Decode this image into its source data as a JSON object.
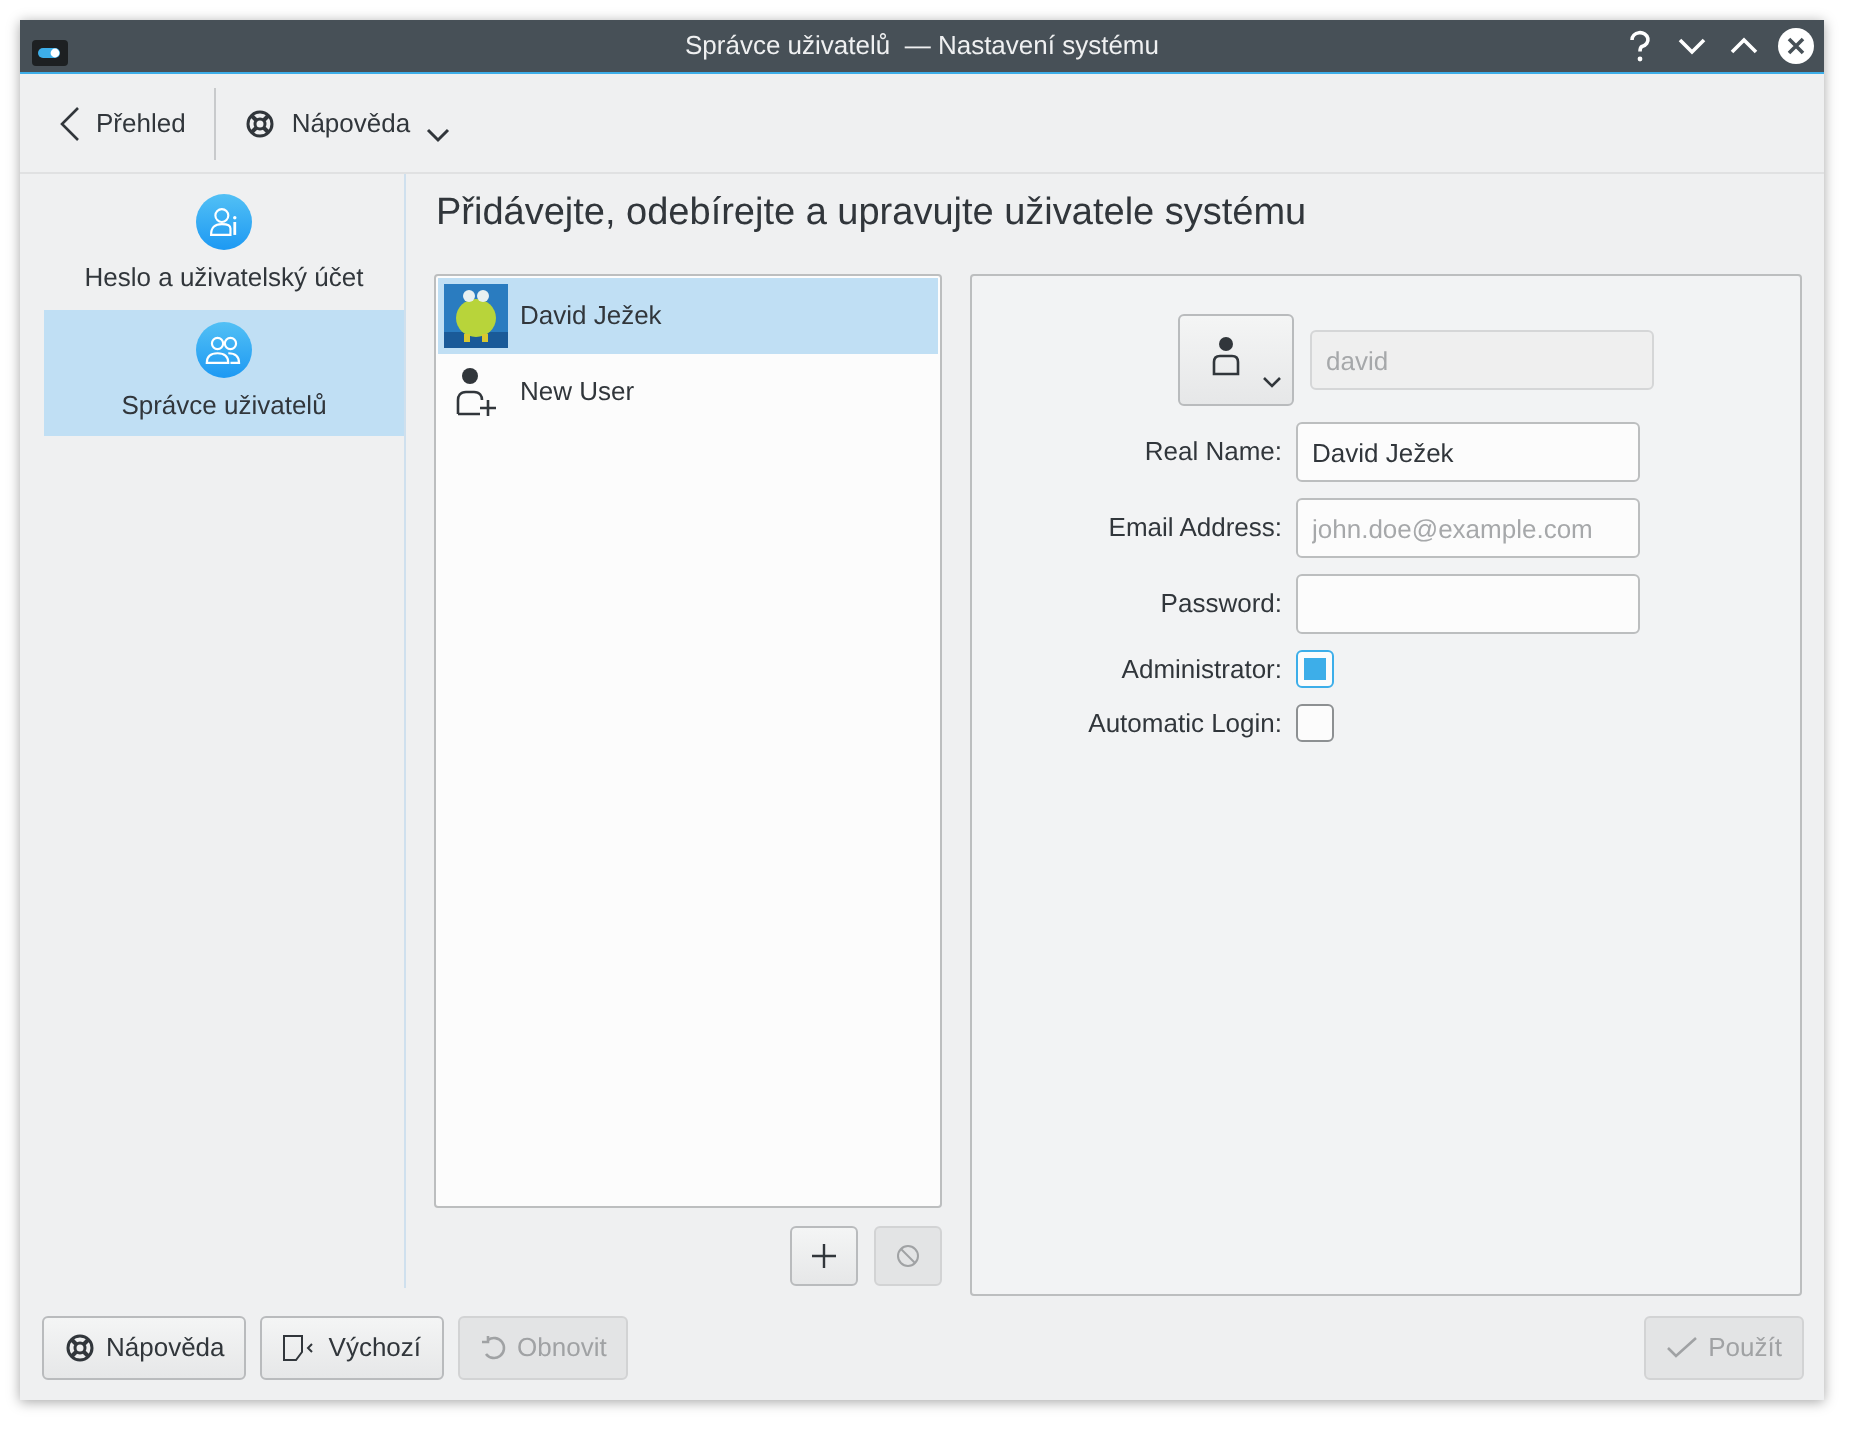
{
  "window": {
    "title": "Správce uživatelů  — Nastavení systému",
    "controls": [
      {
        "kind": "help"
      },
      {
        "kind": "minimize"
      },
      {
        "kind": "maximize"
      },
      {
        "kind": "close"
      }
    ]
  },
  "toolbar": {
    "back": "Přehled",
    "help": "Nápověda"
  },
  "sidebar": {
    "items": [
      {
        "label": "Heslo a uživatelský účet",
        "selected": false,
        "kind": "account"
      },
      {
        "label": "Správce uživatelů",
        "selected": true,
        "kind": "users"
      }
    ]
  },
  "heading": "Přidávejte, odebírejte a upravujte uživatele systému",
  "users": [
    {
      "name": "David Ježek",
      "selected": true
    },
    {
      "name": "New User",
      "selected": false,
      "kind": "new"
    }
  ],
  "list_buttons": [
    {
      "kind": "add",
      "disabled": false
    },
    {
      "kind": "remove",
      "disabled": true
    }
  ],
  "form": {
    "login": {
      "value": "david",
      "disabled": true
    },
    "fields": [
      {
        "label": "Real Name:",
        "value": "David Ježek"
      },
      {
        "label": "Email Address:",
        "placeholder": "john.doe@example.com"
      },
      {
        "label": "Password:"
      }
    ],
    "checkboxes": [
      {
        "label": "Administrator:",
        "checked": true
      },
      {
        "label": "Automatic Login:",
        "checked": false
      }
    ]
  },
  "footer": [
    {
      "label": "Nápověda",
      "kind": "help",
      "disabled": false
    },
    {
      "label": "Výchozí",
      "kind": "defaults",
      "disabled": false
    },
    {
      "label": "Obnovit",
      "kind": "reset",
      "disabled": true
    },
    {
      "label": "Použít",
      "kind": "apply",
      "disabled": true
    }
  ]
}
